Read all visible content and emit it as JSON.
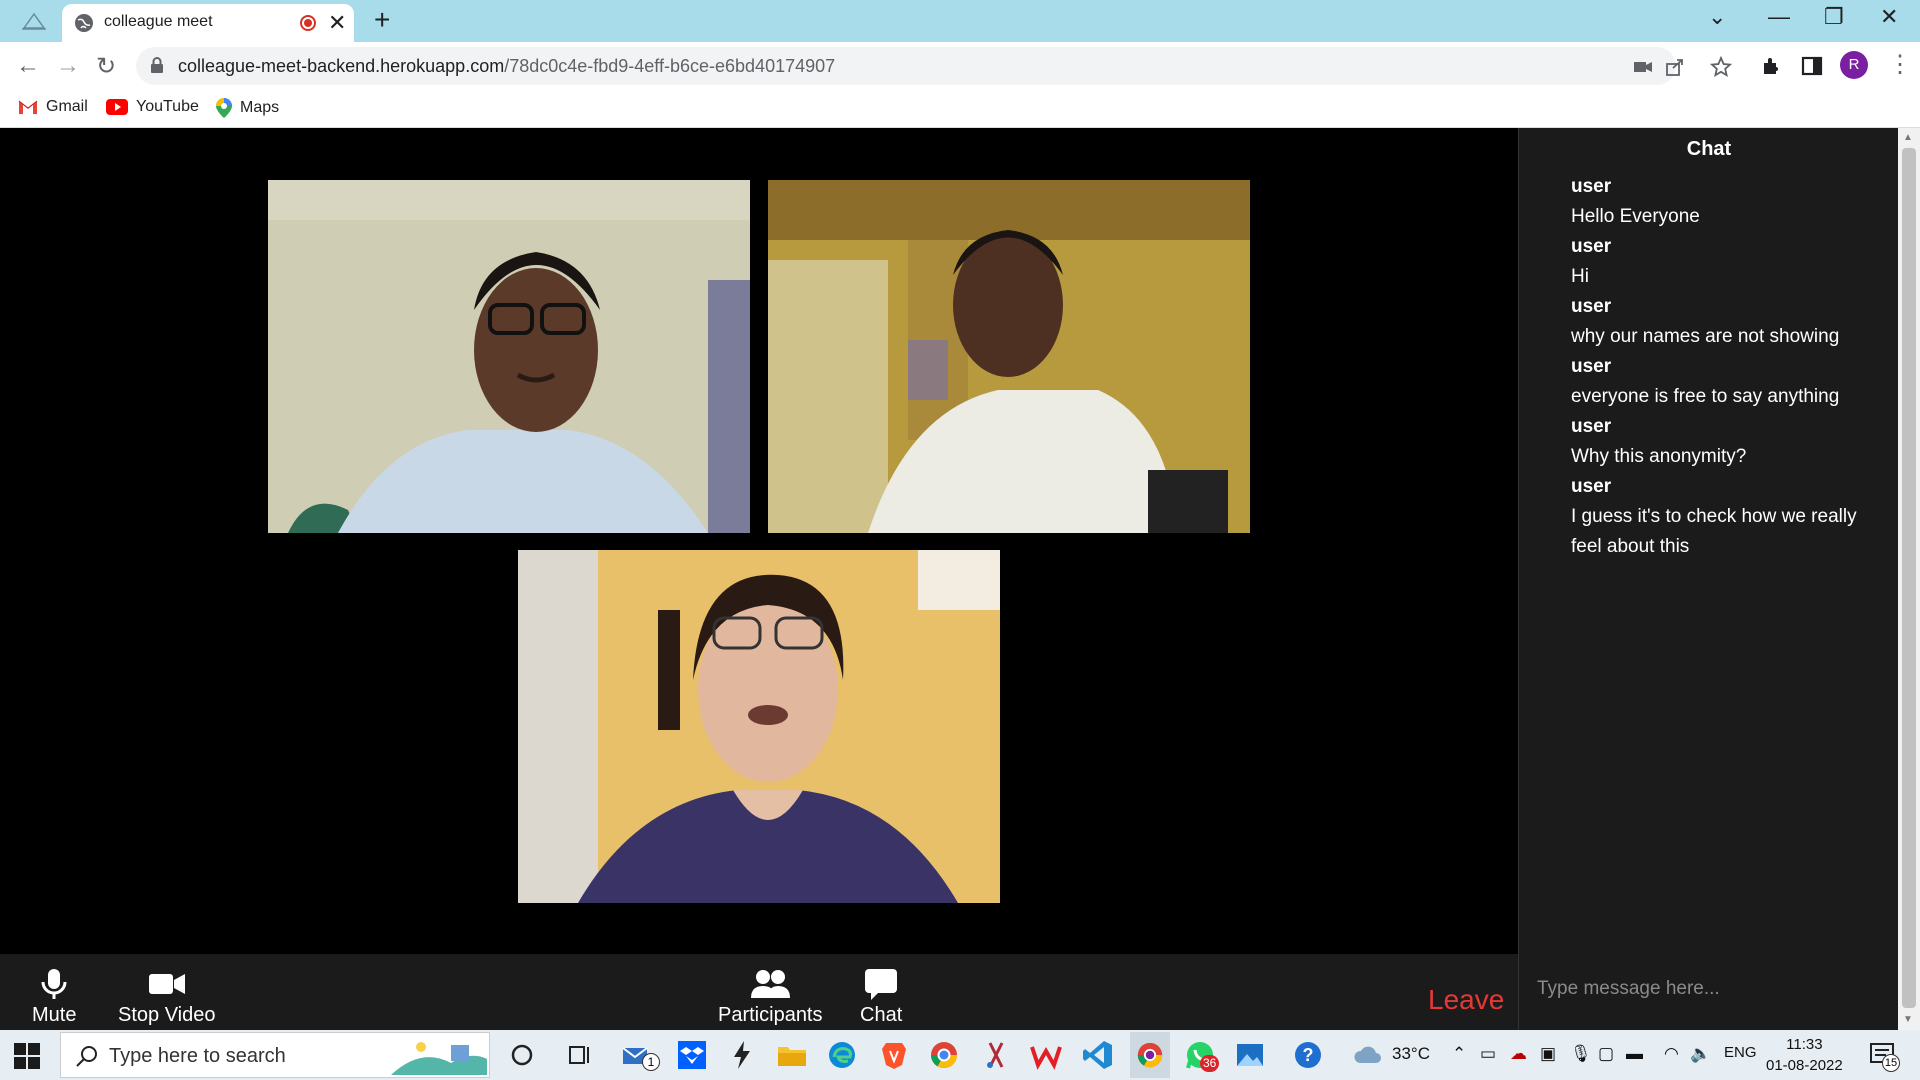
{
  "browser": {
    "tab_title": "colleague meet",
    "url_host": "colleague-meet-backend.herokuapp.com",
    "url_path": "/78dc0c4e-fbd9-4eff-b6ce-e6bd40174907",
    "profile_initial": "R",
    "bookmarks": [
      {
        "label": "Gmail",
        "icon": "gmail-icon"
      },
      {
        "label": "YouTube",
        "icon": "youtube-icon"
      },
      {
        "label": "Maps",
        "icon": "maps-icon"
      }
    ]
  },
  "chat": {
    "title": "Chat",
    "messages": [
      {
        "sender": "user",
        "text": "Hello Everyone"
      },
      {
        "sender": "user",
        "text": "Hi"
      },
      {
        "sender": "user",
        "text": "why our names are not showing"
      },
      {
        "sender": "user",
        "text": "everyone is free to say anything"
      },
      {
        "sender": "user",
        "text": "Why this anonymity?"
      },
      {
        "sender": "user",
        "text": "I guess it's to check how we really feel about this"
      }
    ],
    "input_placeholder": "Type message here..."
  },
  "controls": {
    "mute_label": "Mute",
    "stop_video_label": "Stop Video",
    "participants_label": "Participants",
    "chat_label": "Chat",
    "leave_label": "Leave"
  },
  "taskbar": {
    "search_placeholder": "Type here to search",
    "mail_badge": "1",
    "whatsapp_badge": "36",
    "weather": "33°C",
    "language": "ENG",
    "time": "11:33",
    "date": "01-08-2022",
    "notification_count": "15"
  },
  "colors": {
    "leave": "#e53935",
    "chat_bg": "#1b1b1b",
    "titlebar": "#a8dcea",
    "taskbar": "#e7eef3"
  }
}
